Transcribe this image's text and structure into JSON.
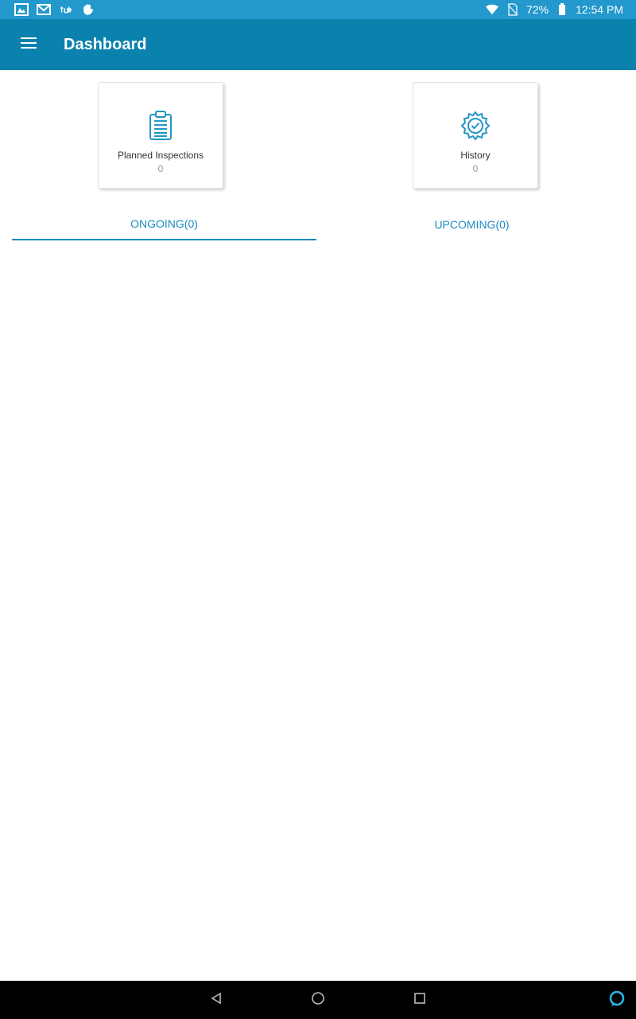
{
  "status_bar": {
    "left_icons": [
      "gallery-icon",
      "gmail-icon",
      "tumblr-icon",
      "hand-icon"
    ],
    "battery": "72%",
    "time": "12:54 PM"
  },
  "app_bar": {
    "title": "Dashboard",
    "menu_icon": "hamburger-menu-icon"
  },
  "cards": [
    {
      "label": "Planned Inspections",
      "count": "0",
      "icon": "clipboard-icon"
    },
    {
      "label": "History",
      "count": "0",
      "icon": "gear-check-icon"
    }
  ],
  "tabs": [
    {
      "label": "ONGOING(0)",
      "selected": true
    },
    {
      "label": "UPCOMING(0)",
      "selected": false
    }
  ],
  "colors": {
    "status_bar": "#2298cc",
    "app_bar": "#0a82ad",
    "accent": "#1a8bc0"
  },
  "nav_bar": {
    "buttons": [
      "back-icon",
      "home-icon",
      "recents-icon",
      "alexa-icon"
    ]
  }
}
